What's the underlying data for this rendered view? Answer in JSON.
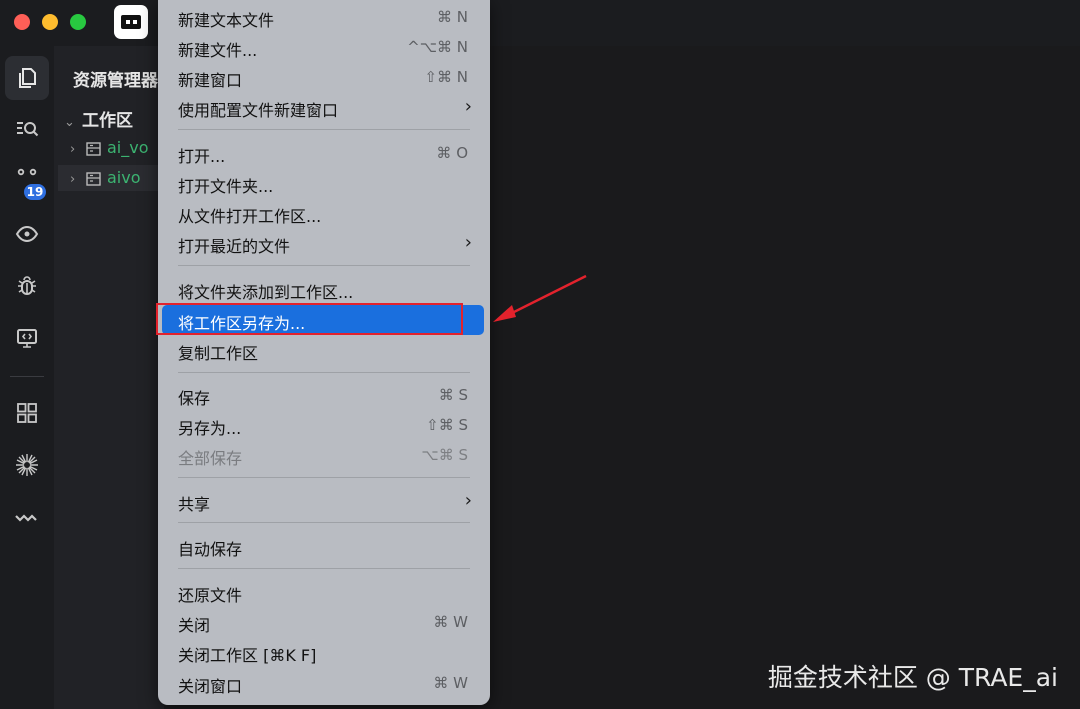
{
  "sidebar": {
    "title": "资源管理器",
    "workspace_label": "工作区",
    "folders": [
      "ai_vo",
      "aivo"
    ]
  },
  "activity_bar": {
    "source_control_badge": "19",
    "icons": [
      "files-icon",
      "search-icon",
      "source-control-icon",
      "eye-icon",
      "bug-icon",
      "remote-display-icon",
      "extensions-icon",
      "sparkle-icon",
      "wave-icon"
    ]
  },
  "menu": {
    "items": [
      {
        "label": "新建文本文件",
        "shortcut": "⌘ N"
      },
      {
        "label": "新建文件...",
        "shortcut": "^⌥⌘ N"
      },
      {
        "label": "新建窗口",
        "shortcut": "⇧⌘ N"
      },
      {
        "label": "使用配置文件新建窗口",
        "shortcut": ""
      },
      {
        "label": "打开...",
        "shortcut": "⌘ O"
      },
      {
        "label": "打开文件夹...",
        "shortcut": ""
      },
      {
        "label": "从文件打开工作区...",
        "shortcut": ""
      },
      {
        "label": "打开最近的文件",
        "shortcut": ""
      },
      {
        "label": "将文件夹添加到工作区...",
        "shortcut": ""
      },
      {
        "label": "将工作区另存为...",
        "shortcut": ""
      },
      {
        "label": "复制工作区",
        "shortcut": ""
      },
      {
        "label": "保存",
        "shortcut": "⌘ S"
      },
      {
        "label": "另存为...",
        "shortcut": "⇧⌘ S"
      },
      {
        "label": "全部保存",
        "shortcut": "⌥⌘ S"
      },
      {
        "label": "共享",
        "shortcut": ""
      },
      {
        "label": "自动保存",
        "shortcut": ""
      },
      {
        "label": "还原文件",
        "shortcut": ""
      },
      {
        "label": "关闭",
        "shortcut": "⌘ W"
      },
      {
        "label": "关闭工作区 [⌘K F]",
        "shortcut": ""
      },
      {
        "label": "关闭窗口",
        "shortcut": "⌘ W"
      }
    ],
    "submenu_arrow": "›",
    "highlighted_item": "将工作区另存为...",
    "disabled_item": "全部保存"
  },
  "colors": {
    "menu_background": "#b9bcc2",
    "highlight": "#1a6fde",
    "annotation_red": "#e3222c",
    "folder_green": "#3cb371",
    "badge_blue": "#2f6fe0"
  },
  "watermark": "掘金技术社区 @ TRAE_ai"
}
